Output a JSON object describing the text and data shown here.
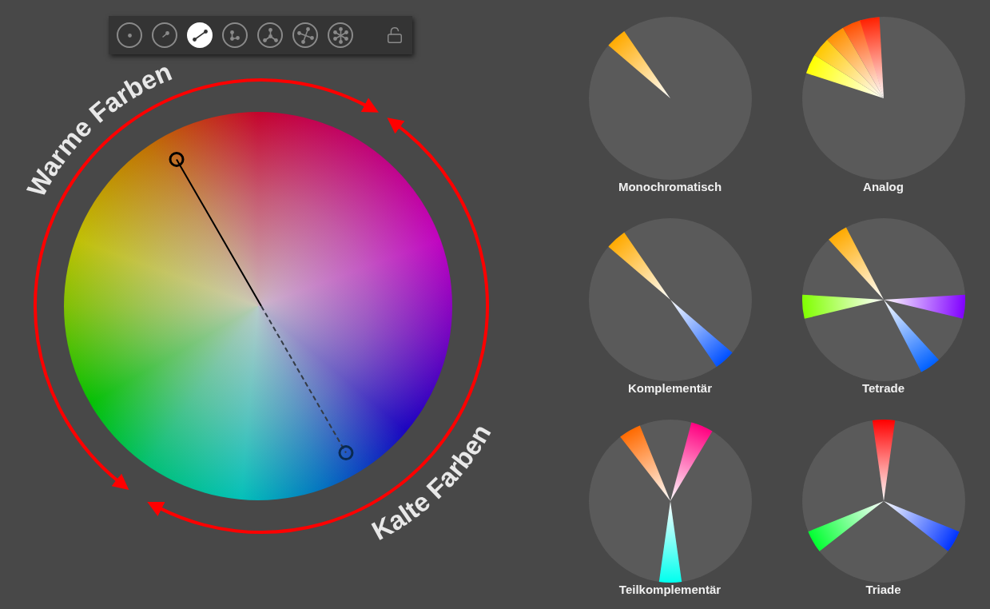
{
  "toolbar": {
    "modes": [
      {
        "kind": "single",
        "selected": false
      },
      {
        "kind": "shades",
        "selected": false
      },
      {
        "kind": "complementary",
        "selected": true
      },
      {
        "kind": "split",
        "selected": false
      },
      {
        "kind": "triad",
        "selected": false
      },
      {
        "kind": "tetrad",
        "selected": false
      },
      {
        "kind": "hexad",
        "selected": false
      }
    ]
  },
  "wheel": {
    "warm_label": "Warme Farben",
    "cold_label": "Kalte Farben"
  },
  "schemes": [
    {
      "kind": "mono",
      "label": "Monochromatisch"
    },
    {
      "kind": "analog",
      "label": "Analog"
    },
    {
      "kind": "complementary",
      "label": "Komplementär"
    },
    {
      "kind": "tetrad",
      "label": "Tetrade"
    },
    {
      "kind": "split",
      "label": "Teilkomplementär"
    },
    {
      "kind": "triad",
      "label": "Triade"
    }
  ]
}
